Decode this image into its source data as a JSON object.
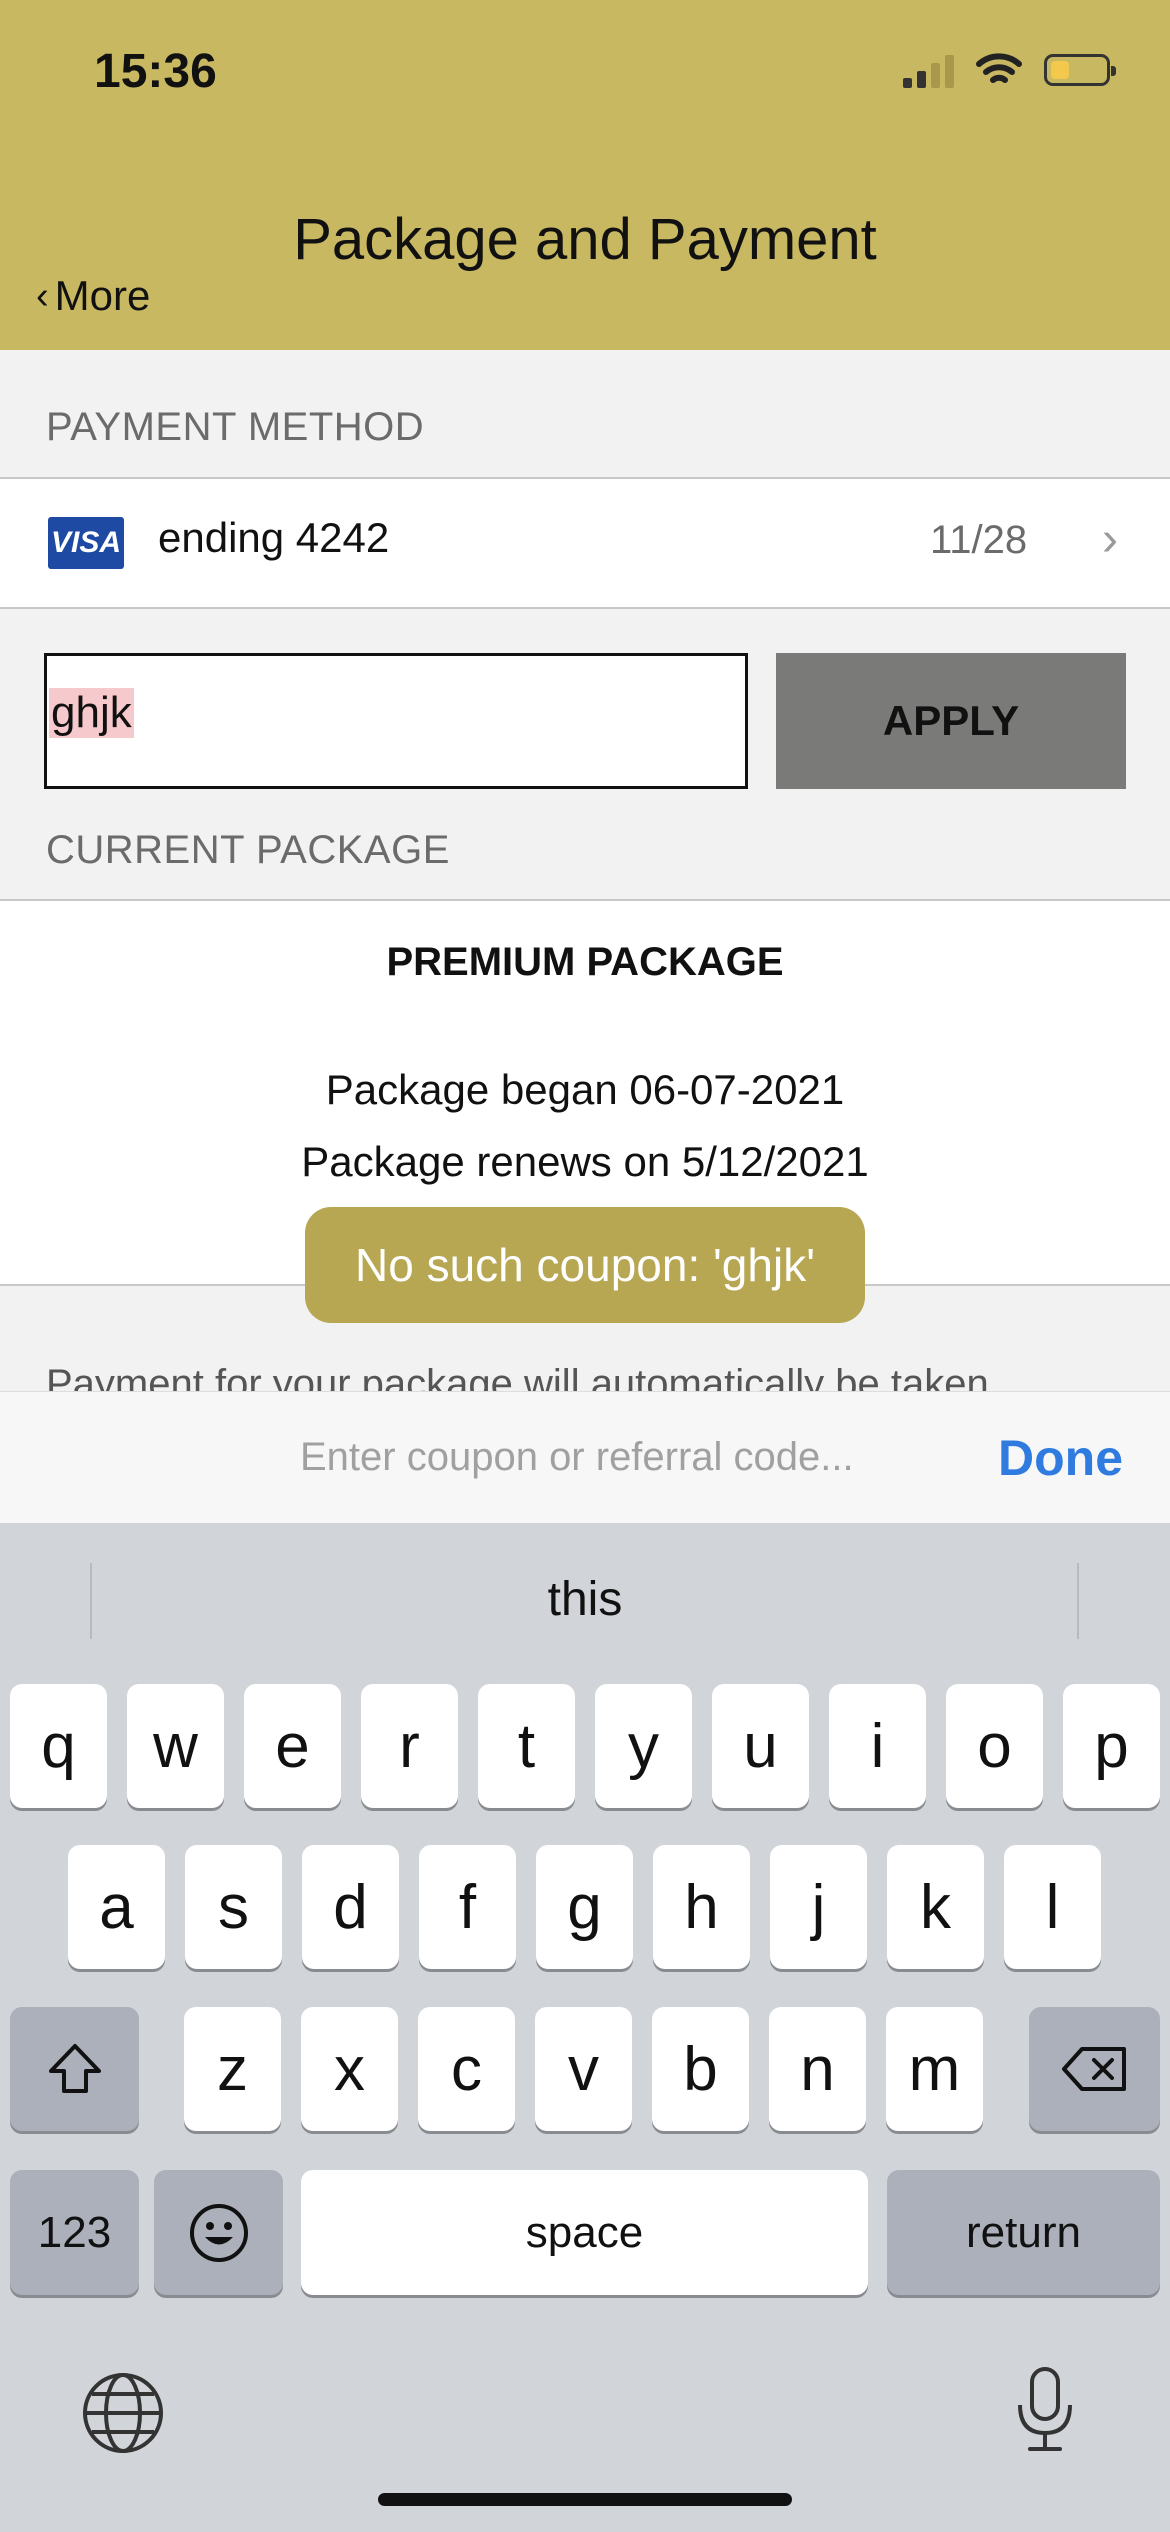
{
  "status_bar": {
    "time": "15:36",
    "battery_level": 0.3
  },
  "header": {
    "title": "Package and Payment",
    "back_label": "More"
  },
  "payment_method": {
    "section_label": "PAYMENT METHOD",
    "card_brand": "VISA",
    "card_label": "ending 4242",
    "expiry": "11/28"
  },
  "coupon": {
    "value": "ghjk",
    "apply_label": "APPLY"
  },
  "current_package": {
    "section_label": "CURRENT PACKAGE",
    "name": "PREMIUM PACKAGE",
    "began": "Package began 06-07-2021",
    "renews": "Package renews on 5/12/2021"
  },
  "footer_text": "Payment for your package will automatically be taken",
  "toast": "No such coupon: 'ghjk'",
  "accessory": {
    "placeholder": "Enter coupon or referral code...",
    "done_label": "Done"
  },
  "keyboard": {
    "suggestion": "this",
    "row1": [
      "q",
      "w",
      "e",
      "r",
      "t",
      "y",
      "u",
      "i",
      "o",
      "p"
    ],
    "row2": [
      "a",
      "s",
      "d",
      "f",
      "g",
      "h",
      "j",
      "k",
      "l"
    ],
    "row3": [
      "z",
      "x",
      "c",
      "v",
      "b",
      "n",
      "m"
    ],
    "numbers_label": "123",
    "space_label": "space",
    "return_label": "return"
  },
  "colors": {
    "header": "#c9b862",
    "toast": "#b7a652",
    "done": "#2f7be0",
    "visa": "#1f4aa3"
  }
}
